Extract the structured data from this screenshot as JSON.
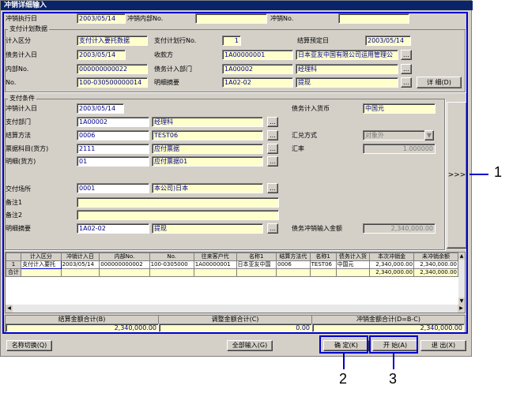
{
  "title": "冲销详细输入",
  "top": {
    "l1": "冲销执行日",
    "v1": "2003/05/14",
    "l2": "冲销内部No.",
    "v2": "",
    "l3": "冲销No.",
    "v3": ""
  },
  "plan": {
    "group": "支付计划数据",
    "r1": {
      "l1": "计入区分",
      "v1": "支付计入要托数据",
      "l2": "支付计划行No.",
      "v2": "1",
      "l3": "结算预定日",
      "v3": "2003/05/14"
    },
    "r2": {
      "l1": "债务计入日",
      "v1": "2003/05/14",
      "l2": "收款方",
      "v2": "1A00000001",
      "v3": "日本亚友中国有限公司运用管理公"
    },
    "r3": {
      "l1": "内部No.",
      "v1": "000000000022",
      "l2": "债务计入部门",
      "v2": "1A00002",
      "v3": "经理科"
    },
    "r4": {
      "l1": "No.",
      "v1": "100-030500000014",
      "l2": "明细摘要",
      "v2": "1A02-02",
      "v3": "提现",
      "detail_btn": "详 细(D)"
    }
  },
  "cond": {
    "group": "支付条件",
    "date_l": "冲销计入日",
    "date_v": "2003/05/14",
    "cur_l": "债务计入货币",
    "cur_v": "中国元",
    "dept_l": "支付部门",
    "dept_code": "1A00002",
    "dept_name": "经理科",
    "method_l": "结算方法",
    "method_code": "0006",
    "method_name": "TEST06",
    "exch_l": "汇兑方式",
    "exch_v": "对象外",
    "acct_l": "票据科目(货方)",
    "acct_code": "2111",
    "acct_name": "应付票据",
    "rate_l": "汇率",
    "rate_v": "1.000000",
    "det_l": "明细(货方)",
    "det_code": "01",
    "det_name": "应付票据01",
    "place_l": "交付场所",
    "place_code": "0001",
    "place_name": "本公司)日本",
    "note1_l": "备注1",
    "note1_v": "",
    "note2_l": "备注2",
    "note2_v": "",
    "sum_l": "明细摘要",
    "sum_code": "1A02-02",
    "sum_name": "提现",
    "amt_l": "债务冲销输入金额",
    "amt_v": "2,340,000.00",
    "side_btn": ">>>"
  },
  "grid": {
    "headers": [
      "",
      "计入区分",
      "冲销计入日",
      "内部No.",
      "No.",
      "往来客户代",
      "名称1",
      "结算方法代",
      "名称1",
      "债务计入货",
      "本次冲销金",
      "未冲销余额"
    ],
    "rows": [
      [
        "1",
        "支付计入要托",
        "2003/05/14",
        "000000000002",
        "100-0305000",
        "1A00000001",
        "日本亚友中国",
        "0006",
        "TEST06",
        "中国元",
        "2,340,000.00",
        "2,340,000.00"
      ],
      [
        "合计",
        "",
        "",
        "",
        "",
        "",
        "",
        "",
        "",
        "",
        "2,340,000.00",
        "2,340,000.00"
      ]
    ]
  },
  "totals": {
    "l1": "结算金额合计(B)",
    "v1": "2,340,000.00",
    "l2": "调整金额合计(C)",
    "v2": "0.00",
    "l3": "冲销金额合计(D=B-C)",
    "v3": "2,340,000.00"
  },
  "buttons": {
    "name_switch": "名称切换(Q)",
    "all_input": "全部输入(G)",
    "ok": "确 定(K)",
    "start": "开 始(A)",
    "exit": "退 出(X)"
  },
  "callouts": {
    "c1": "1",
    "c2": "2",
    "c3": "3"
  },
  "icons": {
    "lookup": "…",
    "dropdown": "▼",
    "scroll_up": "▲",
    "scroll_down": "▼",
    "scroll_left": "◀",
    "scroll_right": "▶"
  }
}
